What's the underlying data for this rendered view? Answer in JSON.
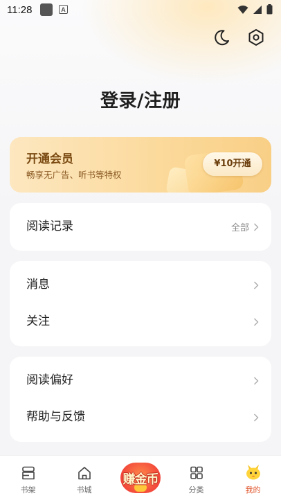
{
  "status_bar": {
    "time": "11:28",
    "notif_icon_letter": "A"
  },
  "header": {
    "title": "登录/注册"
  },
  "vip": {
    "title": "开通会员",
    "subtitle": "畅享无广告、听书等特权",
    "button_label": "¥10开通"
  },
  "reading_card": {
    "label": "阅读记录",
    "right_text": "全部"
  },
  "message_card": {
    "items": [
      {
        "label": "消息"
      },
      {
        "label": "关注"
      }
    ]
  },
  "prefs_card": {
    "items": [
      {
        "label": "阅读偏好"
      },
      {
        "label": "帮助与反馈"
      }
    ]
  },
  "tabbar": {
    "items": [
      {
        "label": "书架",
        "icon": "bookshelf-icon"
      },
      {
        "label": "书城",
        "icon": "home-icon"
      },
      {
        "label": "赚金币",
        "icon": "earn-coins-badge"
      },
      {
        "label": "分类",
        "icon": "grid-icon"
      },
      {
        "label": "我的",
        "icon": "mascot-icon",
        "active": true
      }
    ],
    "active_color": "#e0562d"
  }
}
